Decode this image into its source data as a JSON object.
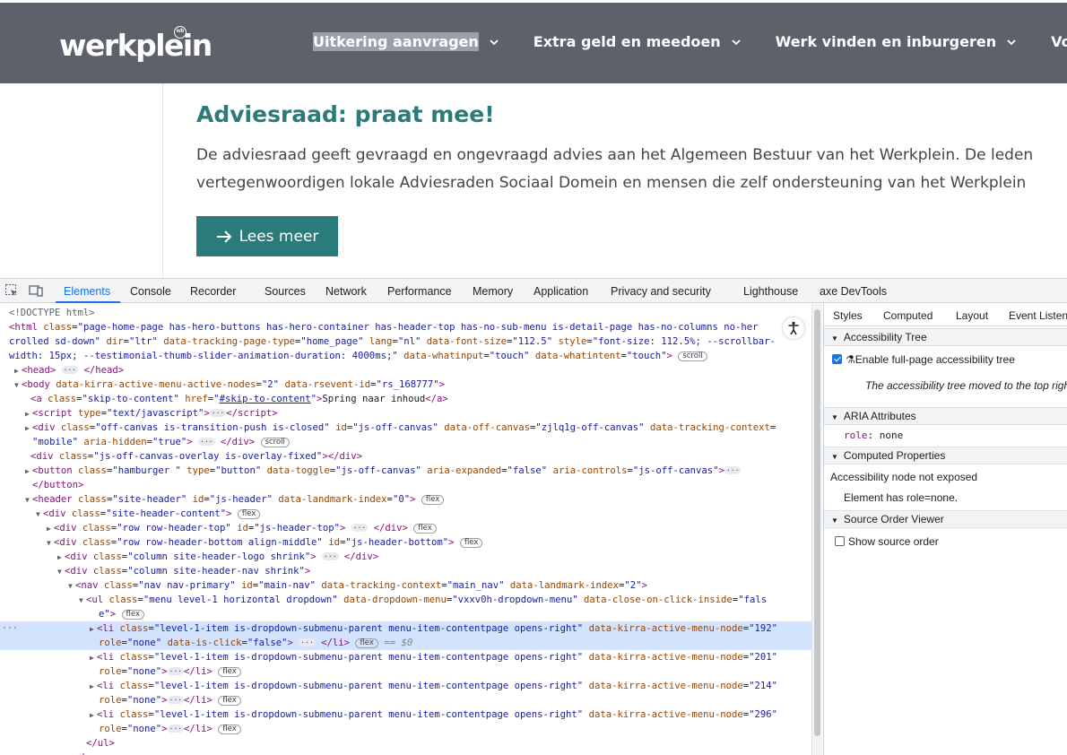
{
  "site": {
    "logo": "werkplein",
    "logo_badge": "wb",
    "nav": [
      {
        "label": "Uitkering aanvragen"
      },
      {
        "label": "Extra geld en meedoen"
      },
      {
        "label": "Werk vinden en inburgeren"
      },
      {
        "label": "Voor werkgevers"
      }
    ],
    "hero_title": "Adviesraad: praat mee!",
    "hero_line1": "De adviesraad geeft gevraagd en ongevraagd advies aan het Algemeen Bestuur van het Werkplein. De leden",
    "hero_line2": "vertegenwoordigen lokale Adviesraden Sociaal Domein en mensen die zelf ondersteuning van het Werkplein",
    "hero_button": "Lees meer",
    "highlight_color": "#9aa0a8",
    "header_color": "#5d6169",
    "accent_color": "#2b7b7a"
  },
  "devtools": {
    "tabs": [
      "Elements",
      "Console",
      "Recorder",
      "Sources",
      "Network",
      "Performance",
      "Memory",
      "Application",
      "Privacy and security",
      "Lighthouse",
      "axe DevTools"
    ],
    "active_tab": "Elements",
    "dom_badges": {
      "flex": "flex",
      "scroll": "scroll",
      "ellipsis": "···",
      "eq": "== $0"
    },
    "side_tabs": [
      "Styles",
      "Computed",
      "Layout",
      "Event Listeners"
    ],
    "a11y": {
      "tree_header": "Accessibility Tree",
      "enable_label": "Enable full-page accessibility tree",
      "moved_note": "The accessibility tree moved to the top right",
      "aria_header": "ARIA Attributes",
      "role_key": "role",
      "role_val": ": none",
      "computed_header": "Computed Properties",
      "not_exposed": "Accessibility node not exposed",
      "has_role": "Element has role=none.",
      "source_header": "Source Order Viewer",
      "show_source": "Show source order"
    }
  }
}
